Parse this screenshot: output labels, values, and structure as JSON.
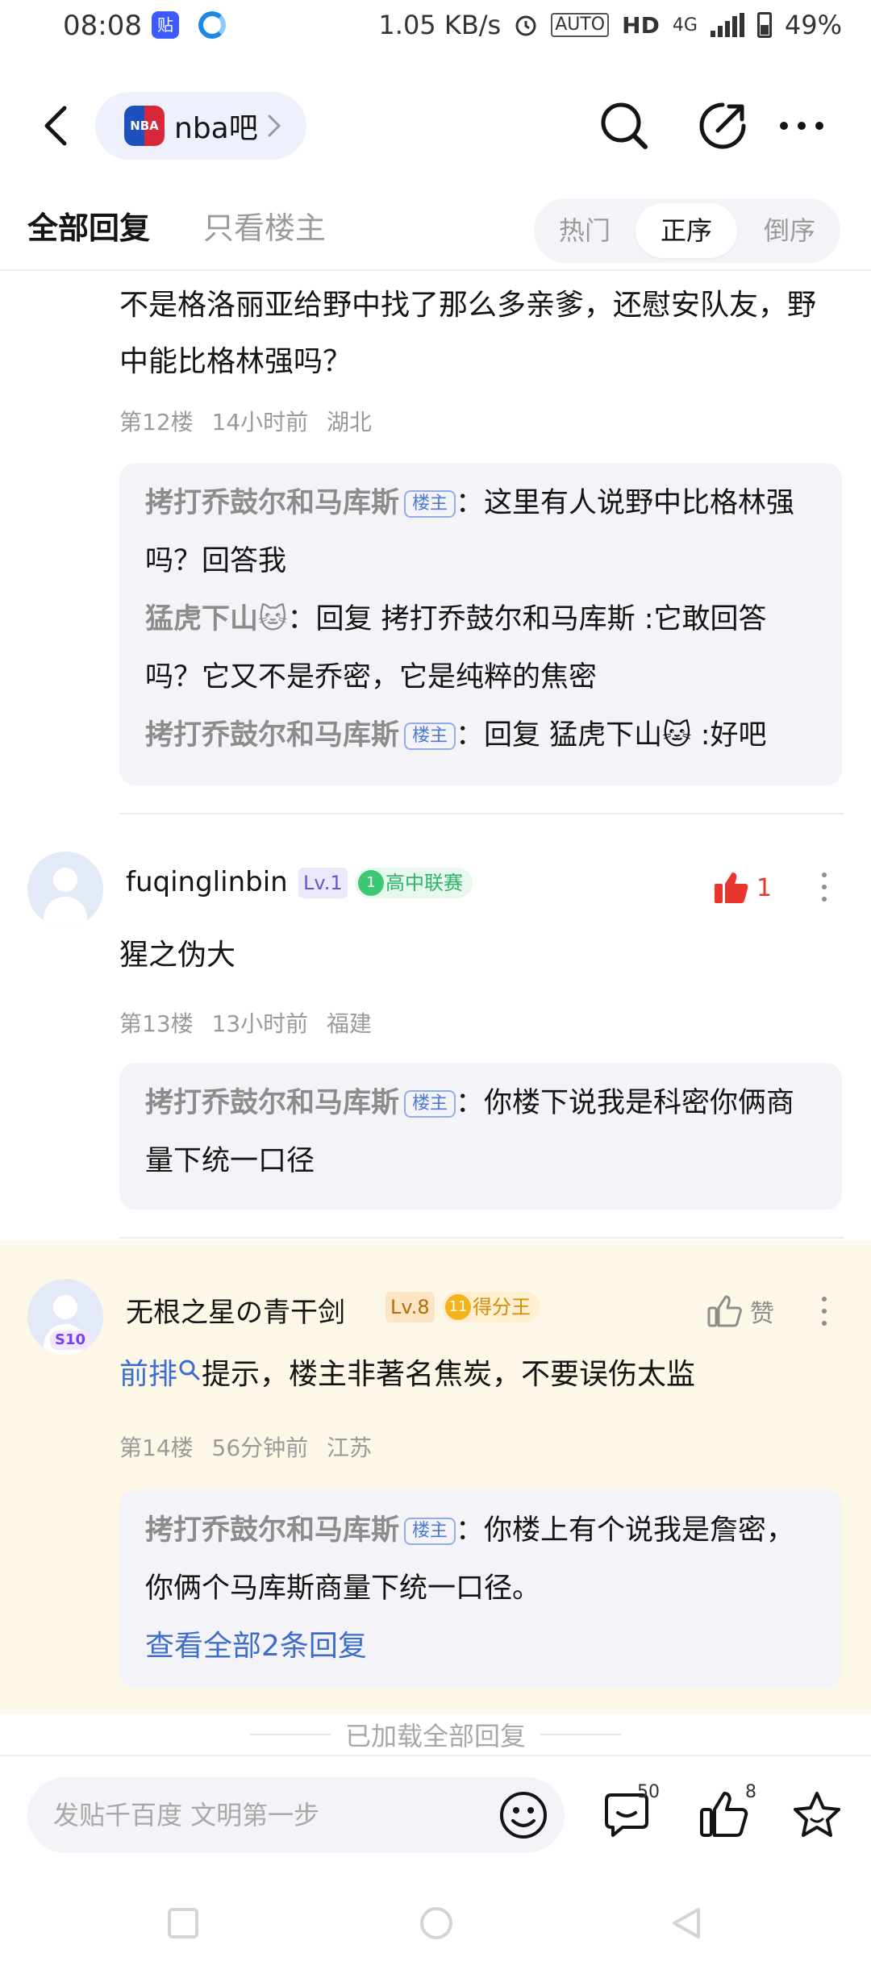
{
  "status_bar": {
    "time": "08:08",
    "app1_label": "贴",
    "speed": "1.05 KB/s",
    "auto": "AUTO",
    "hd": "HD",
    "net": "4G",
    "battery": "49%"
  },
  "nav": {
    "logo_text": "NBA",
    "forum_name": "nba吧",
    "icons": [
      "back-icon",
      "chevron-right-icon",
      "search-icon",
      "edit-icon",
      "more-icon"
    ]
  },
  "tabs": {
    "all_replies": "全部回复",
    "op_only": "只看楼主",
    "sort": [
      "热门",
      "正序",
      "倒序"
    ],
    "active_sort": "正序"
  },
  "posts": [
    {
      "content": "不是格洛丽亚给野中找了那么多亲爹，还慰安队友，野中能比格林强吗？",
      "meta": "第12楼 14小时前 湖北",
      "replies": [
        {
          "name": "拷打乔鼓尔和马库斯",
          "is_op": true,
          "op_label": "楼主",
          "text": "：这里有人说野中比格林强吗？回答我"
        },
        {
          "name": "猛虎下山🐱",
          "is_op": false,
          "text": "：回复 拷打乔鼓尔和马库斯 :它敢回答吗？它又不是乔密，它是纯粹的焦密"
        },
        {
          "name": "拷打乔鼓尔和马库斯",
          "is_op": true,
          "op_label": "楼主",
          "text": "：回复 猛虎下山🐱 :好吧"
        }
      ]
    },
    {
      "username": "fuqinglinbin",
      "level": "Lv.1",
      "tag_num": "1",
      "tag": "高中联赛",
      "likes": "1",
      "content": "猩之伪大",
      "meta": "第13楼 13小时前 福建",
      "replies": [
        {
          "name": "拷打乔鼓尔和马库斯",
          "is_op": true,
          "op_label": "楼主",
          "text": "：你楼下说我是科密你俩商量下统一口径"
        }
      ]
    },
    {
      "username": "无根之星の青干剑",
      "level": "Lv.8",
      "tag_num": "11",
      "tag": "得分王",
      "avatar_badge": "S10",
      "like_label": "赞",
      "content_link": "前排",
      "content": "提示，楼主非著名焦炭，不要误伤太监",
      "meta": "第14楼 56分钟前 江苏",
      "replies": [
        {
          "name": "拷打乔鼓尔和马库斯",
          "is_op": true,
          "op_label": "楼主",
          "text": "：你楼上有个说我是詹密，你俩个马库斯商量下统一口径。"
        }
      ],
      "view_all": "查看全部2条回复"
    }
  ],
  "loaded_all": "已加载全部回复",
  "bottom_bar": {
    "input_placeholder": "发贴千百度 文明第一步",
    "comment_count": "50",
    "like_count": "8"
  },
  "colors": {
    "accent_blue": "#3d6dcc",
    "like_red": "#e8352d",
    "highlight_bg": "#fdf7e8",
    "reply_bg": "#f4f4f8"
  }
}
